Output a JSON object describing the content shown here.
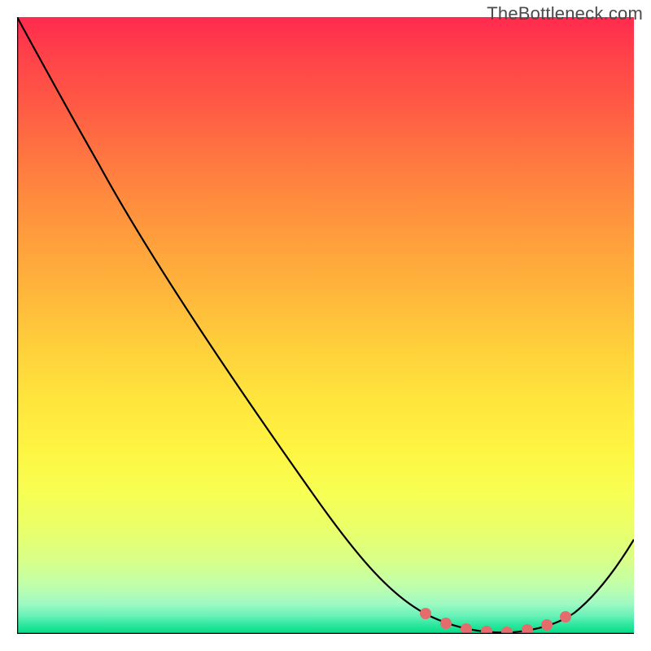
{
  "watermark": "TheBottleneck.com",
  "chart_data": {
    "type": "line",
    "title": "",
    "xlabel": "",
    "ylabel": "",
    "x_range_norm": [
      0,
      1
    ],
    "y_range_norm": [
      0,
      1
    ],
    "series": [
      {
        "name": "curve",
        "points": [
          {
            "x": 0.0,
            "y": 1.0
          },
          {
            "x": 0.07,
            "y": 0.9
          },
          {
            "x": 0.18,
            "y": 0.72
          },
          {
            "x": 0.3,
            "y": 0.54
          },
          {
            "x": 0.42,
            "y": 0.36
          },
          {
            "x": 0.54,
            "y": 0.18
          },
          {
            "x": 0.6,
            "y": 0.09
          },
          {
            "x": 0.66,
            "y": 0.035
          },
          {
            "x": 0.72,
            "y": 0.01
          },
          {
            "x": 0.77,
            "y": 0.004
          },
          {
            "x": 0.82,
            "y": 0.004
          },
          {
            "x": 0.86,
            "y": 0.01
          },
          {
            "x": 0.9,
            "y": 0.03
          },
          {
            "x": 0.95,
            "y": 0.08
          },
          {
            "x": 1.0,
            "y": 0.15
          }
        ]
      },
      {
        "name": "marker-points",
        "points": [
          {
            "x": 0.66,
            "y": 0.035
          },
          {
            "x": 0.695,
            "y": 0.016
          },
          {
            "x": 0.73,
            "y": 0.007
          },
          {
            "x": 0.765,
            "y": 0.004
          },
          {
            "x": 0.8,
            "y": 0.004
          },
          {
            "x": 0.835,
            "y": 0.007
          },
          {
            "x": 0.865,
            "y": 0.014
          },
          {
            "x": 0.895,
            "y": 0.028
          }
        ]
      }
    ],
    "colors": {
      "curve": "#000000",
      "markers": "#e46c6c",
      "gradient_top": "#ff2a4e",
      "gradient_bottom": "#00db84"
    }
  }
}
